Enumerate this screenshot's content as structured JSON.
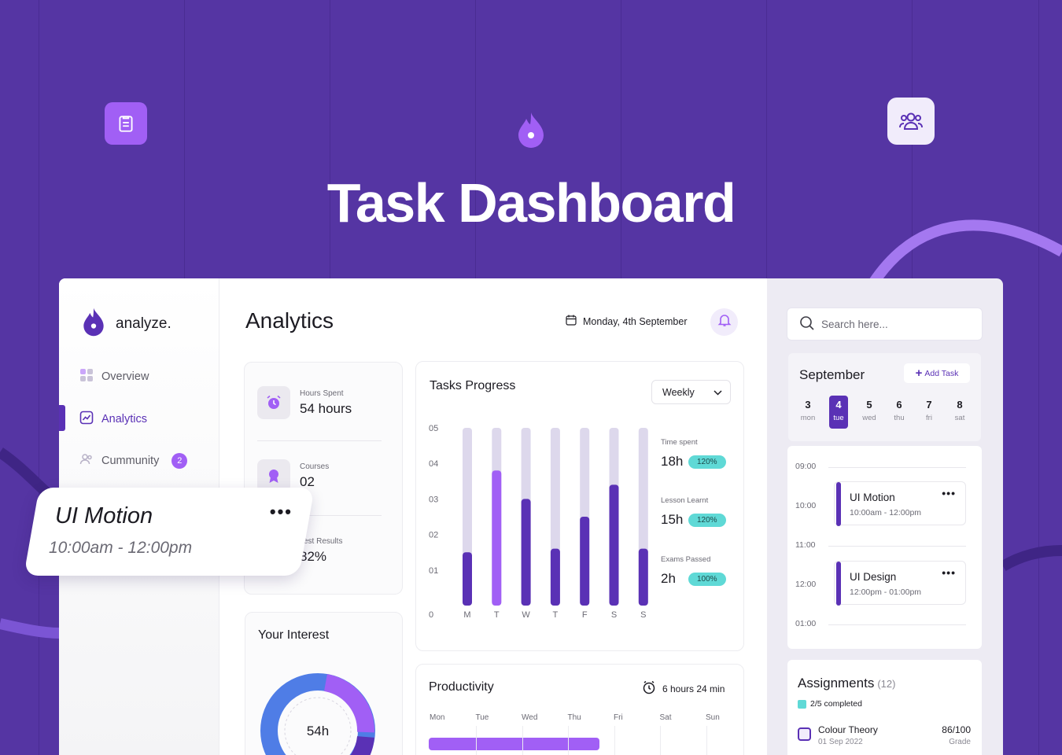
{
  "hero": {
    "title": "Task Dashboard",
    "icons": [
      "clipboard-icon",
      "flame-icon",
      "users-icon"
    ]
  },
  "colors": {
    "background": "#5535a3",
    "accent": "#5a31b5",
    "accent_light": "#a15ff5",
    "track": "#ddd8ec",
    "badge": "#5fd9d6"
  },
  "sidebar": {
    "brand": "analyze.",
    "items": [
      {
        "label": "Overview",
        "icon": "grid-icon"
      },
      {
        "label": "Analytics",
        "icon": "chart-icon",
        "active": true
      },
      {
        "label": "Cummunity",
        "icon": "users-icon",
        "badge": "2"
      }
    ]
  },
  "header": {
    "title": "Analytics",
    "date": "Monday, 4th September"
  },
  "stats": [
    {
      "label": "Hours Spent",
      "value": "54 hours"
    },
    {
      "label": "Courses",
      "value": "02"
    },
    {
      "label": "Test Results",
      "value": "82%"
    }
  ],
  "interest": {
    "title": "Your Interest",
    "center": "54h"
  },
  "tasks_progress": {
    "title": "Tasks Progress",
    "period": "Weekly",
    "metrics": [
      {
        "label": "Time spent",
        "value": "18h",
        "badge": "120%"
      },
      {
        "label": "Lesson Learnt",
        "value": "15h",
        "badge": "120%"
      },
      {
        "label": "Exams Passed",
        "value": "2h",
        "badge": "100%"
      }
    ]
  },
  "chart_data": {
    "type": "bar",
    "title": "Tasks Progress",
    "categories": [
      "M",
      "T",
      "W",
      "T",
      "F",
      "S",
      "S"
    ],
    "y_ticks": [
      "05",
      "04",
      "03",
      "02",
      "01",
      "0"
    ],
    "ylim": [
      0,
      5
    ],
    "values": [
      1.5,
      3.8,
      3.0,
      1.6,
      2.5,
      3.4,
      1.6
    ],
    "max_values": [
      5,
      5,
      5,
      5,
      5,
      5,
      5
    ],
    "highlight_index": 1
  },
  "productivity": {
    "title": "Productivity",
    "time": "6 hours 24 min",
    "days": [
      "Mon",
      "Tue",
      "Wed",
      "Thu",
      "Fri",
      "Sat",
      "Sun"
    ]
  },
  "search": {
    "placeholder": "Search here..."
  },
  "calendar": {
    "month": "September",
    "add_label": "Add Task",
    "days": [
      {
        "num": "3",
        "name": "mon"
      },
      {
        "num": "4",
        "name": "tue",
        "selected": true
      },
      {
        "num": "5",
        "name": "wed"
      },
      {
        "num": "6",
        "name": "thu"
      },
      {
        "num": "7",
        "name": "fri"
      },
      {
        "num": "8",
        "name": "sat"
      }
    ]
  },
  "schedule": {
    "slots": [
      "09:00",
      "10:00",
      "11:00",
      "12:00",
      "01:00"
    ],
    "events": [
      {
        "title": "UI Motion",
        "time": "10:00am - 12:00pm"
      },
      {
        "title": "UI Design",
        "time": "12:00pm - 01:00pm"
      }
    ]
  },
  "assignments": {
    "title": "Assignments",
    "count": "(12)",
    "completed": "2/5 completed",
    "items": [
      {
        "name": "Colour Theory",
        "date": "01 Sep 2022",
        "score": "86/100",
        "grade": "Grade"
      }
    ]
  },
  "floating_card": {
    "title": "UI Motion",
    "time": "10:00am - 12:00pm"
  }
}
